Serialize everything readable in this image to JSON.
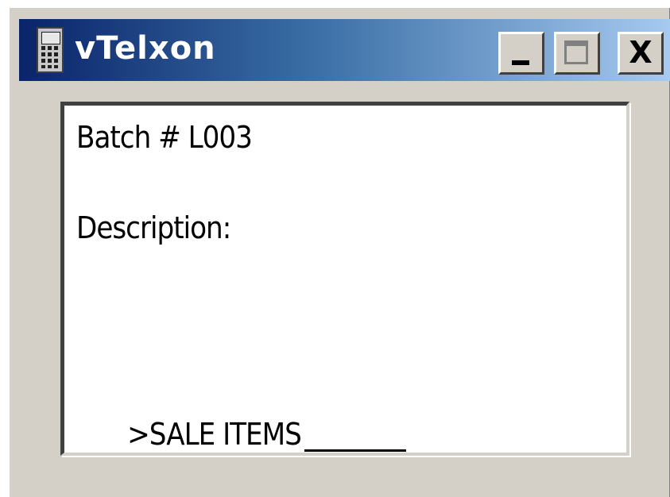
{
  "window": {
    "title": "vTelxon",
    "icon": "handheld-terminal-icon",
    "controls": {
      "minimize": "minimize-icon",
      "maximize": "maximize-icon",
      "close": "close-icon",
      "close_glyph": "X"
    }
  },
  "screen": {
    "batch_line": "Batch # L003",
    "description_label": "Description:",
    "prompt_text": ">SALE ITEMS",
    "input_value": ""
  },
  "colors": {
    "titlebar_start": "#0a246a",
    "titlebar_end": "#a6caf0",
    "window_face": "#d4d0c8",
    "screen_bg": "#ffffff"
  }
}
